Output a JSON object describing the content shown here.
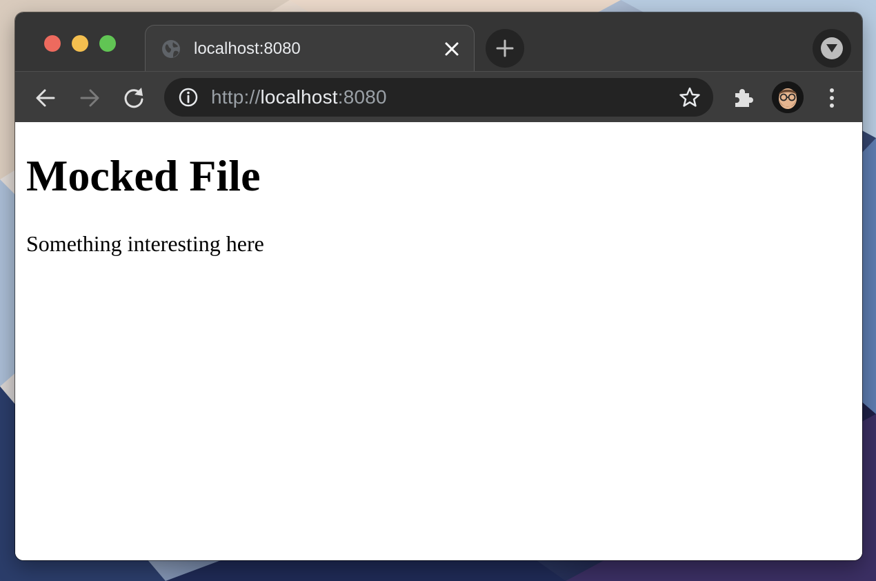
{
  "browser": {
    "tab": {
      "title": "localhost:8080"
    },
    "address_bar": {
      "scheme": "http://",
      "host": "localhost",
      "port": ":8080"
    }
  },
  "page": {
    "heading": "Mocked File",
    "paragraph": "Something interesting here"
  },
  "colors": {
    "traffic_close": "#ed6a5e",
    "traffic_minimize": "#f4bf4f",
    "traffic_zoom": "#61c554",
    "chrome_dark": "#353535",
    "toolbar": "#3c3c3c",
    "omnibox": "#232323"
  },
  "icons": {
    "tab_favicon": "globe-icon",
    "tab_close": "close-icon",
    "new_tab": "plus-icon",
    "tab_search": "chevron-down-icon",
    "back": "arrow-left-icon",
    "forward": "arrow-right-icon",
    "reload": "reload-icon",
    "site_info": "info-icon",
    "bookmark": "star-icon",
    "extensions": "puzzle-icon",
    "profile": "avatar",
    "menu": "kebab-menu-icon"
  }
}
